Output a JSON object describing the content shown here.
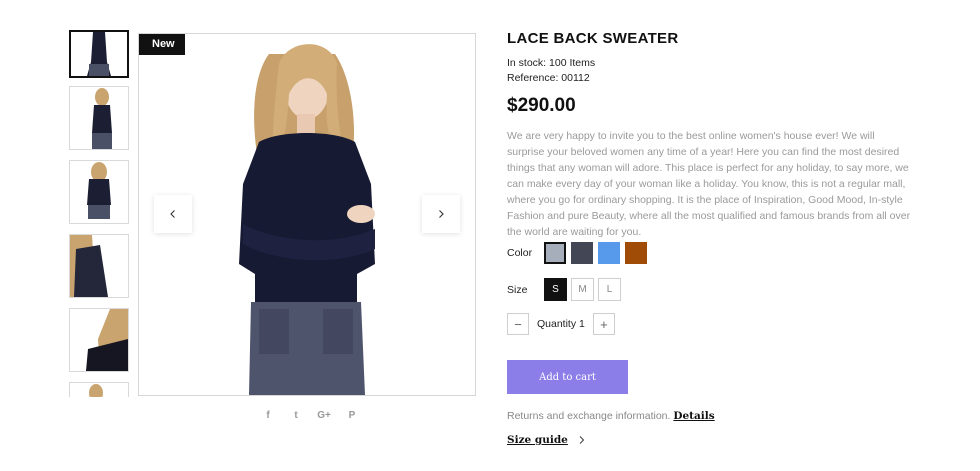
{
  "product": {
    "badge": "New",
    "title": "LACE BACK SWEATER",
    "stock": "In stock: 100 Items",
    "reference": "Reference: 00112",
    "price": "$290.00",
    "description": "We are very happy to invite you to the best online women's house ever! We will surprise your beloved women any time of a year! Here you can find the most desired things that any woman will adore. This place is perfect for any holiday, to say more, we can make every day of your woman like a holiday. You know, this is not a regular mall, where you go for ordinary shopping. It is the place of Inspiration, Good Mood, In-style Fashion and pure Beauty, where all the most qualified and famous brands from all over the world are waiting for you."
  },
  "options": {
    "color_label": "Color",
    "colors": [
      "#a6adbb",
      "#434755",
      "#5799ea",
      "#a04b06"
    ],
    "selected_color": 0,
    "size_label": "Size",
    "sizes": [
      "S",
      "M",
      "L"
    ],
    "selected_size": 0,
    "quantity_text": "Quantity 1",
    "minus": "−",
    "plus": "+"
  },
  "cart": {
    "label": "Add to cart"
  },
  "footer": {
    "returns_text": "Returns and exchange information.",
    "details_link": "Details",
    "size_guide": "Size guide"
  },
  "social": [
    "f",
    "t",
    "G+",
    "P"
  ],
  "icons": {
    "prev": "chevron-left-icon",
    "next": "chevron-right-icon",
    "size_guide": "chevron-right-icon"
  }
}
